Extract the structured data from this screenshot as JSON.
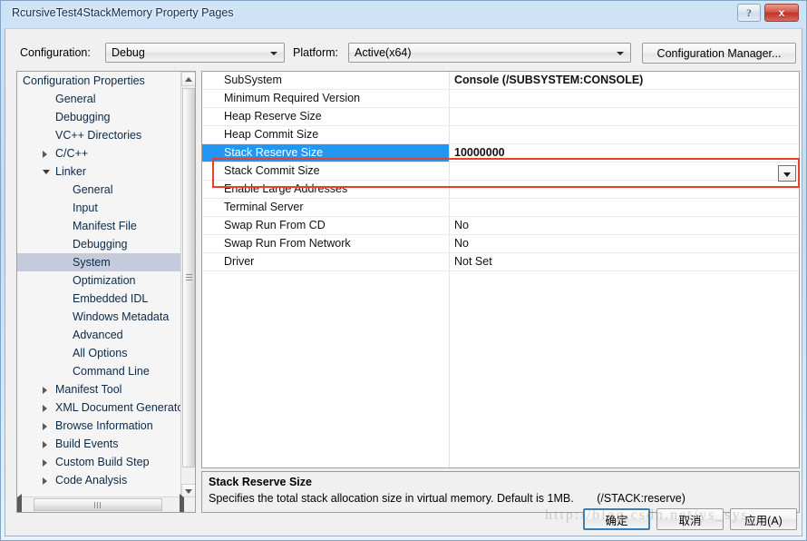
{
  "window": {
    "title": "RcursiveTest4StackMemory Property Pages",
    "help_button": "?",
    "close_button": "x"
  },
  "toolbar": {
    "configuration_label": "Configuration:",
    "configuration_value": "Debug",
    "platform_label": "Platform:",
    "platform_value": "Active(x64)",
    "configuration_manager_label": "Configuration Manager..."
  },
  "tree": {
    "items": [
      {
        "label": "Configuration Properties",
        "indent": 6,
        "arrow": "expanded",
        "selected": false
      },
      {
        "label": "General",
        "indent": 42,
        "arrow": "none",
        "selected": false
      },
      {
        "label": "Debugging",
        "indent": 42,
        "arrow": "none",
        "selected": false
      },
      {
        "label": "VC++ Directories",
        "indent": 42,
        "arrow": "none",
        "selected": false
      },
      {
        "label": "C/C++",
        "indent": 42,
        "arrow": "collapsed",
        "selected": false
      },
      {
        "label": "Linker",
        "indent": 42,
        "arrow": "expanded",
        "selected": false
      },
      {
        "label": "General",
        "indent": 61,
        "arrow": "none",
        "selected": false
      },
      {
        "label": "Input",
        "indent": 61,
        "arrow": "none",
        "selected": false
      },
      {
        "label": "Manifest File",
        "indent": 61,
        "arrow": "none",
        "selected": false
      },
      {
        "label": "Debugging",
        "indent": 61,
        "arrow": "none",
        "selected": false
      },
      {
        "label": "System",
        "indent": 61,
        "arrow": "none",
        "selected": true
      },
      {
        "label": "Optimization",
        "indent": 61,
        "arrow": "none",
        "selected": false
      },
      {
        "label": "Embedded IDL",
        "indent": 61,
        "arrow": "none",
        "selected": false
      },
      {
        "label": "Windows Metadata",
        "indent": 61,
        "arrow": "none",
        "selected": false
      },
      {
        "label": "Advanced",
        "indent": 61,
        "arrow": "none",
        "selected": false
      },
      {
        "label": "All Options",
        "indent": 61,
        "arrow": "none",
        "selected": false
      },
      {
        "label": "Command Line",
        "indent": 61,
        "arrow": "none",
        "selected": false
      },
      {
        "label": "Manifest Tool",
        "indent": 42,
        "arrow": "collapsed",
        "selected": false
      },
      {
        "label": "XML Document Generator",
        "indent": 42,
        "arrow": "collapsed",
        "selected": false
      },
      {
        "label": "Browse Information",
        "indent": 42,
        "arrow": "collapsed",
        "selected": false
      },
      {
        "label": "Build Events",
        "indent": 42,
        "arrow": "collapsed",
        "selected": false
      },
      {
        "label": "Custom Build Step",
        "indent": 42,
        "arrow": "collapsed",
        "selected": false
      },
      {
        "label": "Code Analysis",
        "indent": 42,
        "arrow": "collapsed",
        "selected": false
      }
    ]
  },
  "grid": {
    "rows": [
      {
        "name": "SubSystem",
        "value": "Console (/SUBSYSTEM:CONSOLE)",
        "bold": true,
        "selected": false
      },
      {
        "name": "Minimum Required Version",
        "value": "",
        "bold": false,
        "selected": false
      },
      {
        "name": "Heap Reserve Size",
        "value": "",
        "bold": false,
        "selected": false
      },
      {
        "name": "Heap Commit Size",
        "value": "",
        "bold": false,
        "selected": false
      },
      {
        "name": "Stack Reserve Size",
        "value": "10000000",
        "bold": true,
        "selected": true
      },
      {
        "name": "Stack Commit Size",
        "value": "",
        "bold": false,
        "selected": false
      },
      {
        "name": "Enable Large Addresses",
        "value": "",
        "bold": false,
        "selected": false
      },
      {
        "name": "Terminal Server",
        "value": "",
        "bold": false,
        "selected": false
      },
      {
        "name": "Swap Run From CD",
        "value": "No",
        "bold": false,
        "selected": false
      },
      {
        "name": "Swap Run From Network",
        "value": "No",
        "bold": false,
        "selected": false
      },
      {
        "name": "Driver",
        "value": "Not Set",
        "bold": false,
        "selected": false
      }
    ]
  },
  "description": {
    "title": "Stack Reserve Size",
    "body": "Specifies the total stack allocation size in virtual memory. Default is 1MB.",
    "switch": "(/STACK:reserve)"
  },
  "footer": {
    "ok_label": "确定",
    "cancel_label": "取消",
    "apply_label": "应用(A)"
  },
  "watermark": {
    "text": "http://blog.csdn.net/ys_sys"
  },
  "colors": {
    "accent_selection": "#2196f3",
    "annotation_red": "#e8402a",
    "tree_selection": "#c5cbdb",
    "titlebar_blue": "#cfe2f6"
  }
}
